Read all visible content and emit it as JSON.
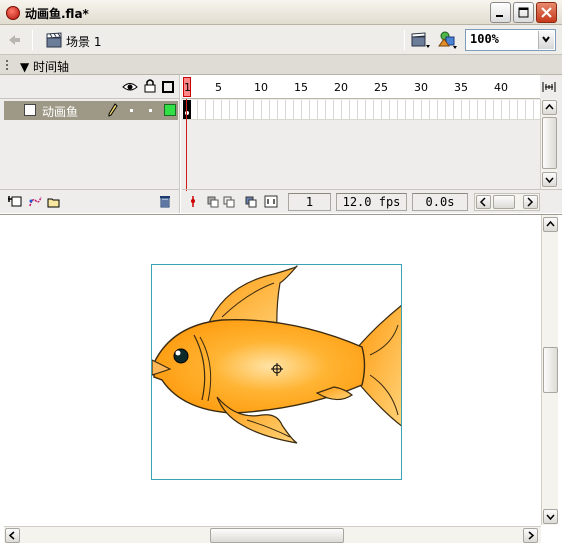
{
  "window": {
    "title": "动画鱼.fla*"
  },
  "toolbar": {
    "scene_label": "场景 1",
    "zoom_value": "100%",
    "icons": [
      "back-arrow-icon",
      "scene-clapper-icon",
      "edit-scene-icon",
      "edit-symbol-icon",
      "chevron-down-icon"
    ]
  },
  "timeline": {
    "panel_title": "时间轴",
    "ruler_numbers": [
      "1",
      "5",
      "10",
      "15",
      "20",
      "25",
      "30",
      "35",
      "40"
    ],
    "layers": [
      {
        "name": "动画鱼",
        "selected": true,
        "outline_color": "#2fe046"
      }
    ],
    "status": {
      "current_frame": "1",
      "frame_rate": "12.0 fps",
      "elapsed_time": "0.0s"
    }
  },
  "colors": {
    "playhead": "#d21d1d",
    "layer_selected_bg": "#9e9986",
    "stage_border": "#39a2b3",
    "fish_fill": "#ffa51c",
    "fish_outline": "#3a2a10"
  }
}
